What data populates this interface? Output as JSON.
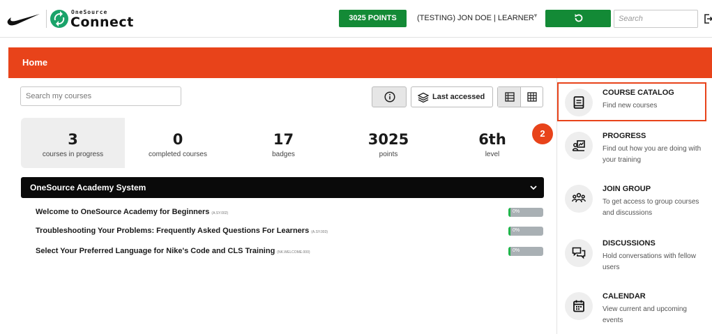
{
  "header": {
    "logo_top": "OneSource",
    "logo_bottom": "Connect",
    "points_label": "3025 POINTS",
    "user_label": "(TESTING) JON DOE | LEARNER",
    "search_placeholder": "Search"
  },
  "home": {
    "title": "Home"
  },
  "toolbar": {
    "search_placeholder": "Search my courses",
    "sort_label": "Last accessed"
  },
  "stats": [
    {
      "value": "3",
      "label": "courses in progress"
    },
    {
      "value": "0",
      "label": "completed courses"
    },
    {
      "value": "17",
      "label": "badges"
    },
    {
      "value": "3025",
      "label": "points"
    },
    {
      "value": "6th",
      "label": "level"
    }
  ],
  "system": {
    "title": "OneSource Academy System",
    "courses": [
      {
        "title": "Welcome to OneSource Academy for Beginners",
        "code": "(A.SY.002)",
        "progress_label": "0%",
        "progress": 0
      },
      {
        "title": "Troubleshooting Your Problems: Frequently Asked Questions For Learners",
        "code": "(A.SY.003)",
        "progress_label": "0%",
        "progress": 0
      },
      {
        "title": "Select Your Preferred Language for Nike's Code and CLS Training",
        "code": "(NK.WELCOME.000)",
        "progress_label": "0%",
        "progress": 0
      }
    ]
  },
  "sidebar": {
    "items": [
      {
        "title": "COURSE CATALOG",
        "desc": "Find new courses",
        "icon": "book-icon"
      },
      {
        "title": "PROGRESS",
        "desc": "Find out how you are doing with your training",
        "icon": "progress-icon"
      },
      {
        "title": "JOIN GROUP",
        "desc": "To get access to group courses and discussions",
        "icon": "group-icon"
      },
      {
        "title": "DISCUSSIONS",
        "desc": "Hold conversations with fellow users",
        "icon": "chat-icon"
      },
      {
        "title": "CALENDAR",
        "desc": "View current and upcoming events",
        "icon": "calendar-icon"
      }
    ]
  },
  "annotation": {
    "step": "2"
  },
  "colors": {
    "accent": "#e8431a",
    "green": "#138a36",
    "progress_track": "#a9b0b4",
    "progress_fill": "#1fb54a"
  }
}
